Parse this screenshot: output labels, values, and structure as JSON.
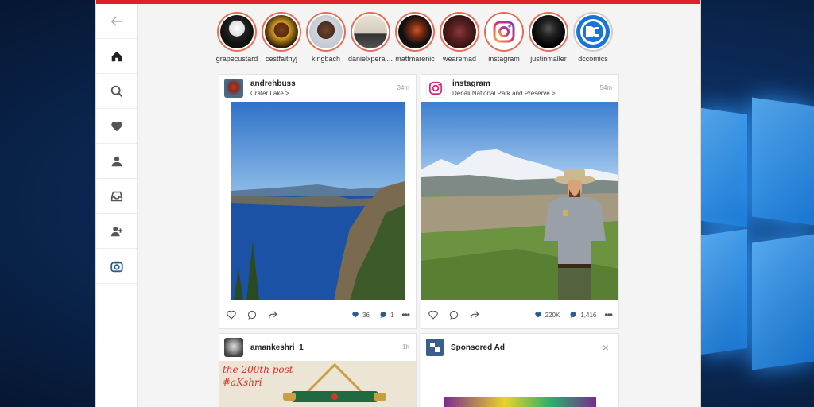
{
  "stories": [
    {
      "name": "grapecustard",
      "seen": false,
      "icon": "avatar"
    },
    {
      "name": "cestfaithyj",
      "seen": false,
      "icon": "avatar"
    },
    {
      "name": "kingbach",
      "seen": false,
      "icon": "avatar"
    },
    {
      "name": "danielxperal...",
      "seen": false,
      "icon": "avatar"
    },
    {
      "name": "mattmarenic",
      "seen": false,
      "icon": "avatar"
    },
    {
      "name": "wearemad",
      "seen": false,
      "icon": "avatar"
    },
    {
      "name": "instagram",
      "seen": false,
      "icon": "instagram-logo"
    },
    {
      "name": "justinmaller",
      "seen": false,
      "icon": "avatar"
    },
    {
      "name": "dccomics",
      "seen": true,
      "icon": "dc-logo"
    }
  ],
  "posts": {
    "p1": {
      "user": "andrehbuss",
      "location": "Crater Lake",
      "time": "34m",
      "likes": "36",
      "comments": "1"
    },
    "p2": {
      "user": "instagram",
      "location": "Denali National Park and Preserve",
      "time": "54m",
      "likes": "220K",
      "comments": "1,416"
    },
    "p3": {
      "user": "amankeshri_1",
      "time": "1h",
      "image_caption": "the 200th post",
      "image_tag": "#aKshri"
    },
    "p4": {
      "user": "Sponsored Ad",
      "close": "×"
    }
  },
  "ui": {
    "more": "•••",
    "location_chevron": ">"
  },
  "colors": {
    "accent": "#e0202c",
    "nav_active": "#2a5b8f"
  }
}
